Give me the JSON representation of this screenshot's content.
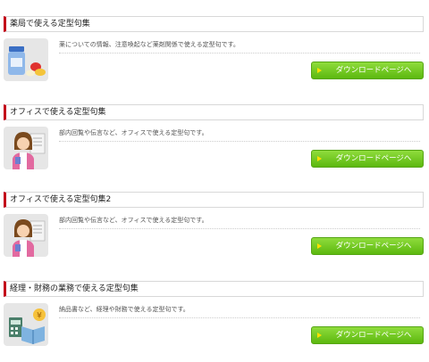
{
  "sections": [
    {
      "title": "薬局で使える定型句集",
      "description": "薬についての情報、注意喚起など薬剤関係で使える定型句です。",
      "button_label": "ダウンロードページへ",
      "icon": "medicine-bottle-icon"
    },
    {
      "title": "オフィスで使える定型句集",
      "description": "部内回覧や伝言など、オフィスで使える定型句です。",
      "button_label": "ダウンロードページへ",
      "icon": "office-woman-icon"
    },
    {
      "title": "オフィスで使える定型句集2",
      "description": "部内回覧や伝言など、オフィスで使える定型句です。",
      "button_label": "ダウンロードページへ",
      "icon": "office-woman-icon"
    },
    {
      "title": "経理・財務の業務で使える定型句集",
      "description": "納品書など、経理や財務で使える定型句です。",
      "button_label": "ダウンロードページへ",
      "icon": "accounting-book-icon"
    }
  ],
  "colors": {
    "accent_red": "#c3001a",
    "button_green": "#5cb80f",
    "button_arrow": "#ffe000"
  }
}
